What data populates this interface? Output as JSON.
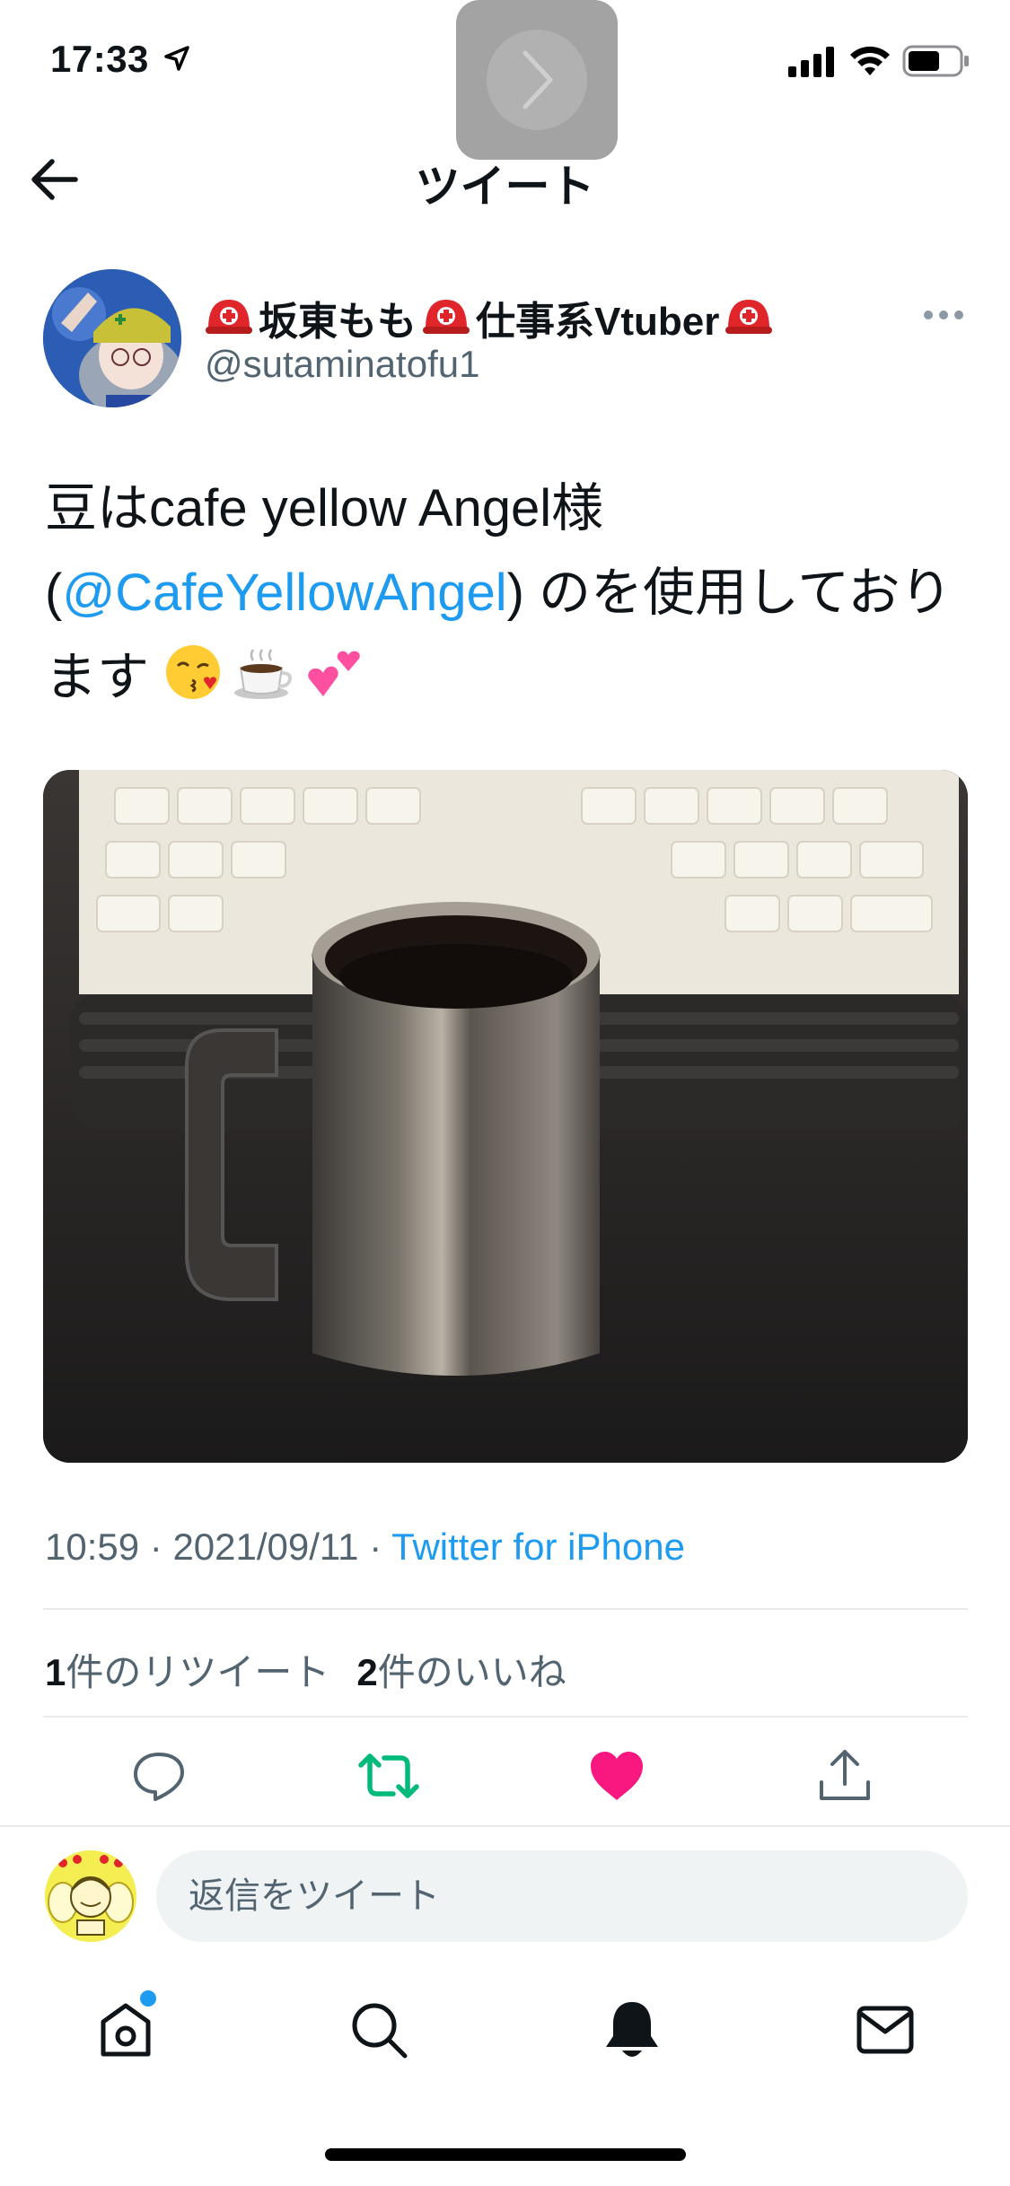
{
  "status_bar": {
    "time": "17:33"
  },
  "header": {
    "title": "ツイート"
  },
  "author": {
    "display_name": "坂東もも",
    "display_name_suffix": "仕事系Vtuber",
    "username": "@sutaminatofu1"
  },
  "tweet": {
    "text_part1": "豆はcafe yellow Angel様(",
    "mention": "@CafeYellowAngel",
    "text_part2": ") のを使用しております"
  },
  "meta": {
    "time": "10:59",
    "separator": " · ",
    "date": "2021/09/11",
    "source": "Twitter for iPhone"
  },
  "counts": {
    "retweets_num": "1",
    "retweets_label": "件のリツイート",
    "likes_num": "2",
    "likes_label": "件のいいね"
  },
  "reply": {
    "placeholder": "返信をツイート"
  },
  "colors": {
    "accent": "#1d9bf0",
    "retweet_active": "#00ba7c",
    "like_active": "#f91880",
    "muted": "#536471"
  },
  "icons": {
    "actions": [
      "reply-icon",
      "retweet-icon",
      "like-icon",
      "share-icon"
    ],
    "nav": [
      "home-icon",
      "search-icon",
      "notifications-icon",
      "messages-icon"
    ]
  }
}
